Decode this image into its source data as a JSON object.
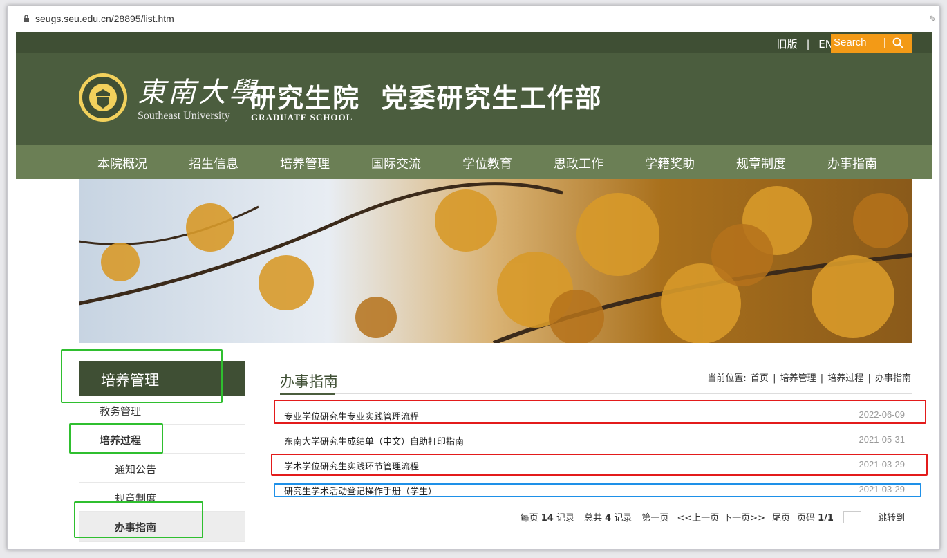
{
  "browser": {
    "url": "seugs.seu.edu.cn/28895/list.htm"
  },
  "topbar": {
    "old_version": "旧版",
    "sep": "|",
    "en": "EN",
    "search_label": "Search",
    "search_sep": "|"
  },
  "header": {
    "logo_cn": "東南大學",
    "logo_en": "Southeast University",
    "title_cn": "研究生院  党委研究生工作部",
    "title_en": "GRADUATE SCHOOL"
  },
  "nav": {
    "items": [
      "本院概况",
      "招生信息",
      "培养管理",
      "国际交流",
      "学位教育",
      "思政工作",
      "学籍奖助",
      "规章制度",
      "办事指南"
    ]
  },
  "sidebar": {
    "title": "培养管理",
    "items": [
      "教务管理",
      "培养过程",
      "通知公告",
      "规章制度",
      "办事指南"
    ]
  },
  "content": {
    "title": "办事指南",
    "breadcrumb": {
      "prefix": "当前位置:",
      "home": "首页",
      "l1": "培养管理",
      "l2": "培养过程",
      "l3": "办事指南",
      "sep": "|"
    },
    "rows": [
      {
        "title": "专业学位研究生专业实践管理流程",
        "date": "2022-06-09"
      },
      {
        "title": "东南大学研究生成绩单（中文）自助打印指南",
        "date": "2021-05-31"
      },
      {
        "title": "学术学位研究生实践环节管理流程",
        "date": "2021-03-29"
      },
      {
        "title": "研究生学术活动登记操作手册（学生）",
        "date": "2021-03-29"
      }
    ],
    "pager": {
      "per_page_a": "每页",
      "per_page_n": "14",
      "per_page_b": "记录",
      "total_a": "总共",
      "total_n": "4",
      "total_b": "记录",
      "first": "第一页",
      "prev": "<<上一页",
      "next": "下一页>>",
      "last": "尾页",
      "page_label": "页码",
      "page_value": "1/1",
      "jump": "跳转到"
    }
  },
  "colors": {
    "header": "#4b5d3e",
    "nav": "#6b7f55",
    "accent": "#f39a16",
    "annot_green": "#2fbf2f",
    "annot_red": "#e31b1b",
    "annot_blue": "#1e90e8"
  }
}
